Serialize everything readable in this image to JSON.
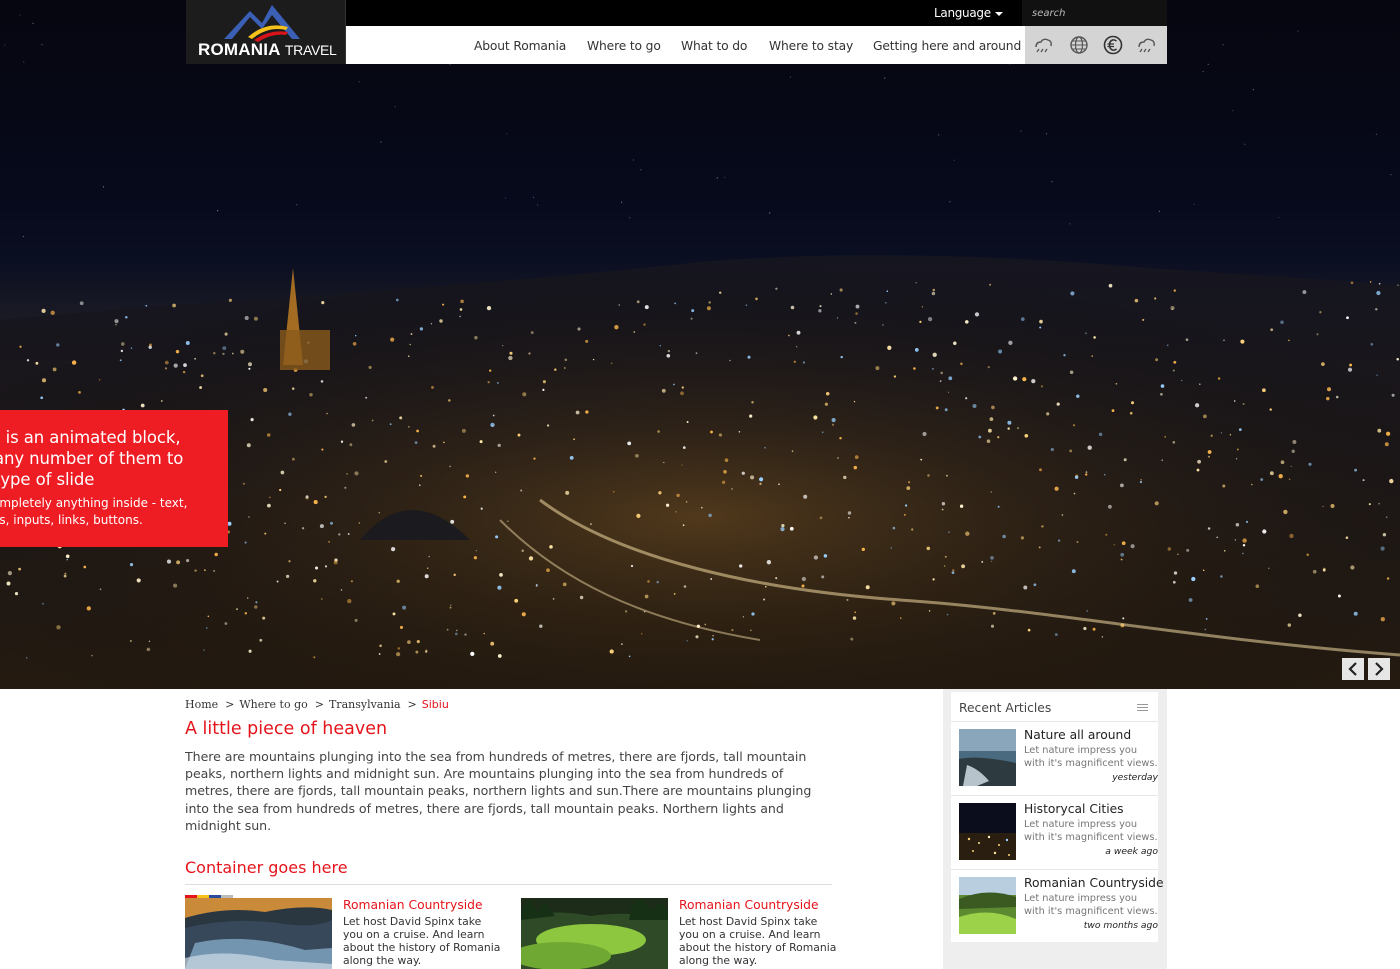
{
  "brand": {
    "name_bold": "ROMANIA",
    "name_light": "TRAVEL"
  },
  "topbar": {
    "language_label": "Language",
    "search_placeholder": "search"
  },
  "nav": {
    "items": [
      "About Romania",
      "Where to go",
      "What to do",
      "Where to stay",
      "Getting here and around"
    ],
    "icons": [
      "weather-icon",
      "globe-icon",
      "euro-icon",
      "weather-icon"
    ]
  },
  "hero": {
    "callout_lines": [
      "s is an animated block,",
      " any number of them to",
      " type of slide"
    ],
    "callout_sub": [
      "ompletely anything inside - text,",
      "es, inputs, links, buttons."
    ]
  },
  "breadcrumb": {
    "items": [
      "Home",
      "Where to go",
      "Transylvania"
    ],
    "current": "Sibiu",
    "separator": ">"
  },
  "page": {
    "title": "A little piece of heaven",
    "intro": "There are mountains plunging into the sea from hundreds of metres, there are fjords, tall mountain peaks, northern lights and midnight sun. Are mountains plunging into the sea from hundreds of metres, there are fjords, tall mountain peaks, northern lights and sun.There are mountains plunging into the sea from hundreds of metres, there are fjords, tall mountain peaks. Northern lights and midnight sun."
  },
  "section": {
    "title": "Container goes here",
    "cards": [
      {
        "title": "Romanian Countryside",
        "desc": "Let host David Spinx take you on a cruise. And learn about the history of Romania along the way."
      },
      {
        "title": "Romanian Countryside",
        "desc": "Let host David Spinx take you on a cruise. And learn about the history of Romania along the way."
      }
    ]
  },
  "sidebar": {
    "title": "Recent Articles",
    "articles": [
      {
        "title": "Nature all around",
        "desc": "Let nature impress you with it's magnificent views.",
        "date": "yesterday"
      },
      {
        "title": "Historycal Cities",
        "desc": "Let nature impress you with it's magnificent views.",
        "date": "a week ago"
      },
      {
        "title": "Romanian Countryside",
        "desc": "Let nature impress you with it's magnificent views.",
        "date": "two months ago"
      }
    ]
  },
  "colors": {
    "accent": "#e5141b",
    "callout": "#ee1d24",
    "flag_blue": "#2b4a9b",
    "flag_yellow": "#f6c21b",
    "flag_red": "#d7141a"
  }
}
